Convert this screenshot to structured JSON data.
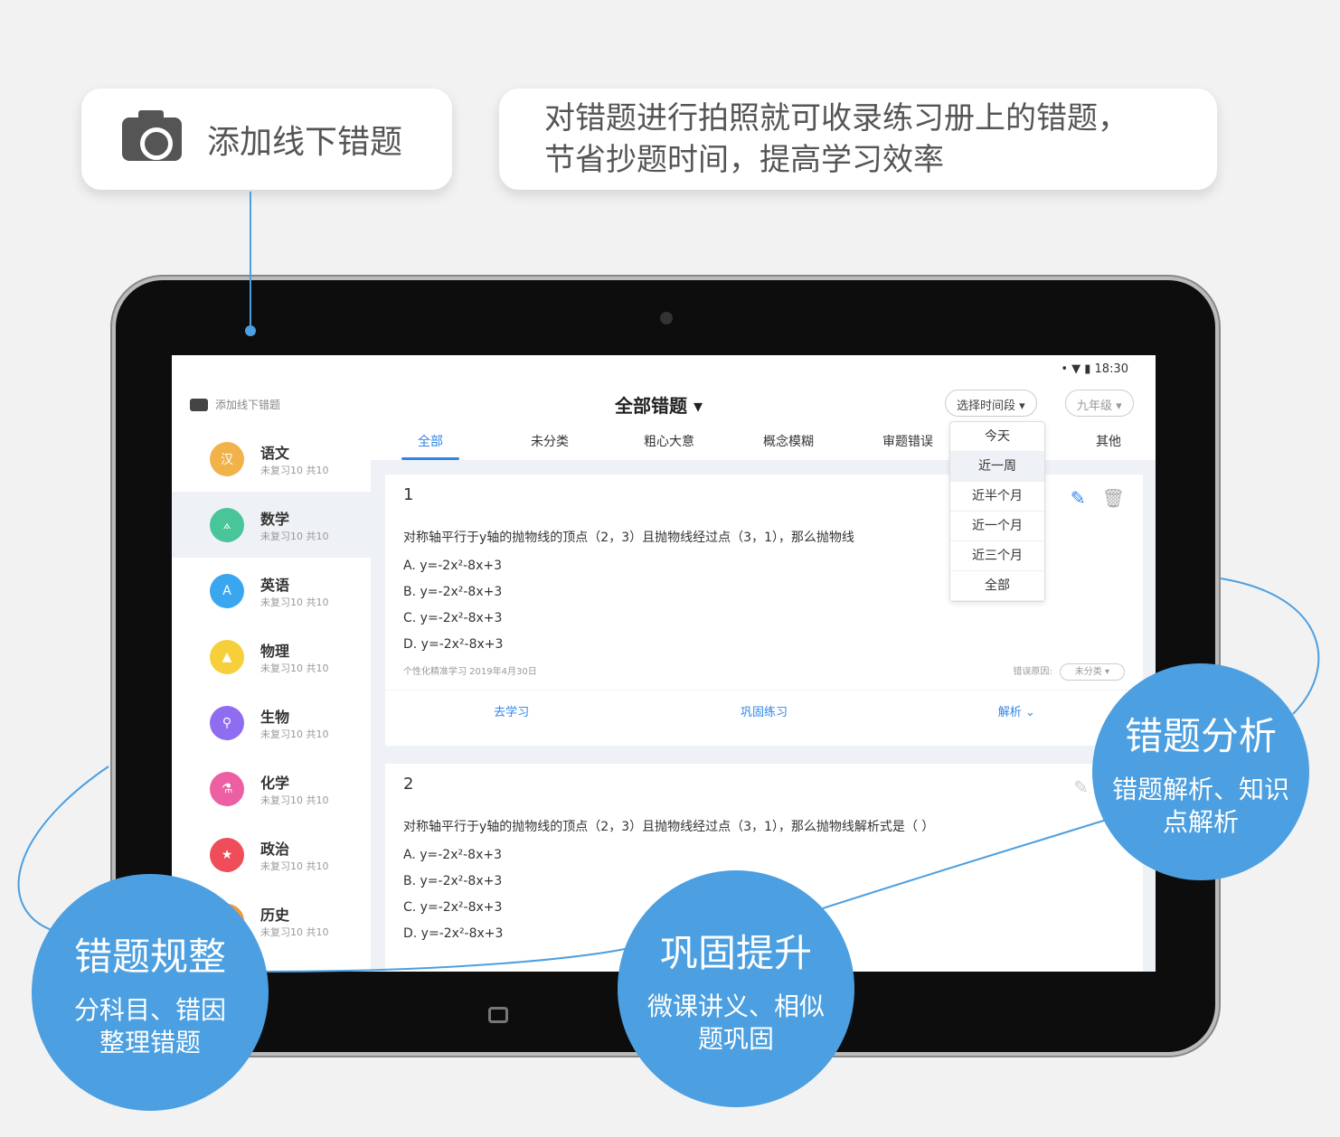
{
  "callouts": {
    "add_offline": "添加线下错题",
    "desc_line1": "对错题进行拍照就可收录练习册上的错题，",
    "desc_line2": "节省抄题时间，提高学习效率"
  },
  "status_bar": {
    "time": "18:30"
  },
  "header": {
    "add_offline": "添加线下错题",
    "title": "全部错题 ▾",
    "time_filter": "选择时间段 ▾",
    "grade": "九年级 ▾"
  },
  "sidebar": [
    {
      "name": "语文",
      "sub": "未复习10 共10",
      "color": "#f2b24a",
      "icon": "汉"
    },
    {
      "name": "数学",
      "sub": "未复习10 共10",
      "color": "#49c59a",
      "icon": "⟑"
    },
    {
      "name": "英语",
      "sub": "未复习10 共10",
      "color": "#3aa6ef",
      "icon": "A"
    },
    {
      "name": "物理",
      "sub": "未复习10 共10",
      "color": "#f6cf3a",
      "icon": "▲"
    },
    {
      "name": "生物",
      "sub": "未复习10 共10",
      "color": "#8f6cf0",
      "icon": "⚲"
    },
    {
      "name": "化学",
      "sub": "未复习10 共10",
      "color": "#ec5fa2",
      "icon": "⚗"
    },
    {
      "name": "政治",
      "sub": "未复习10 共10",
      "color": "#ef4d5a",
      "icon": "★"
    },
    {
      "name": "历史",
      "sub": "未复习10 共10",
      "color": "#f19a3a",
      "icon": "史"
    }
  ],
  "tabs": [
    "全部",
    "未分类",
    "粗心大意",
    "概念模糊",
    "审题错误",
    "其他"
  ],
  "dropdown": [
    "今天",
    "近一周",
    "近半个月",
    "近一个月",
    "近三个月",
    "全部"
  ],
  "cards": [
    {
      "num": "1",
      "question": "对称轴平行于y轴的抛物线的顶点（2，3）且抛物线经过点（3，1），那么抛物线",
      "options": [
        "A.   y=-2x²-8x+3",
        "B.   y=-2x²-8x+3",
        "C.   y=-2x²-8x+3",
        "D.   y=-2x²-8x+3"
      ],
      "source": "个性化精准学习   2019年4月30日",
      "reason_label": "错误原因:",
      "reason": "未分类 ▾",
      "actions": [
        "去学习",
        "巩固练习",
        "解析 ⌄"
      ]
    },
    {
      "num": "2",
      "question": "对称轴平行于y轴的抛物线的顶点（2，3）且抛物线经过点（3，1），那么抛物线解析式是（ ）",
      "options": [
        "A.   y=-2x²-8x+3",
        "B.   y=-2x²-8x+3",
        "C.   y=-2x²-8x+3",
        "D.   y=-2x²-8x+3"
      ]
    }
  ],
  "features": [
    {
      "title": "错题规整",
      "line1": "分科目、错因",
      "line2": "整理错题"
    },
    {
      "title": "巩固提升",
      "line1": "微课讲义、相似",
      "line2": "题巩固"
    },
    {
      "title": "错题分析",
      "line1": "错题解析、知识",
      "line2": "点解析"
    }
  ],
  "colors": {
    "accent": "#2f86e8",
    "bubble": "#4c9fe0"
  }
}
